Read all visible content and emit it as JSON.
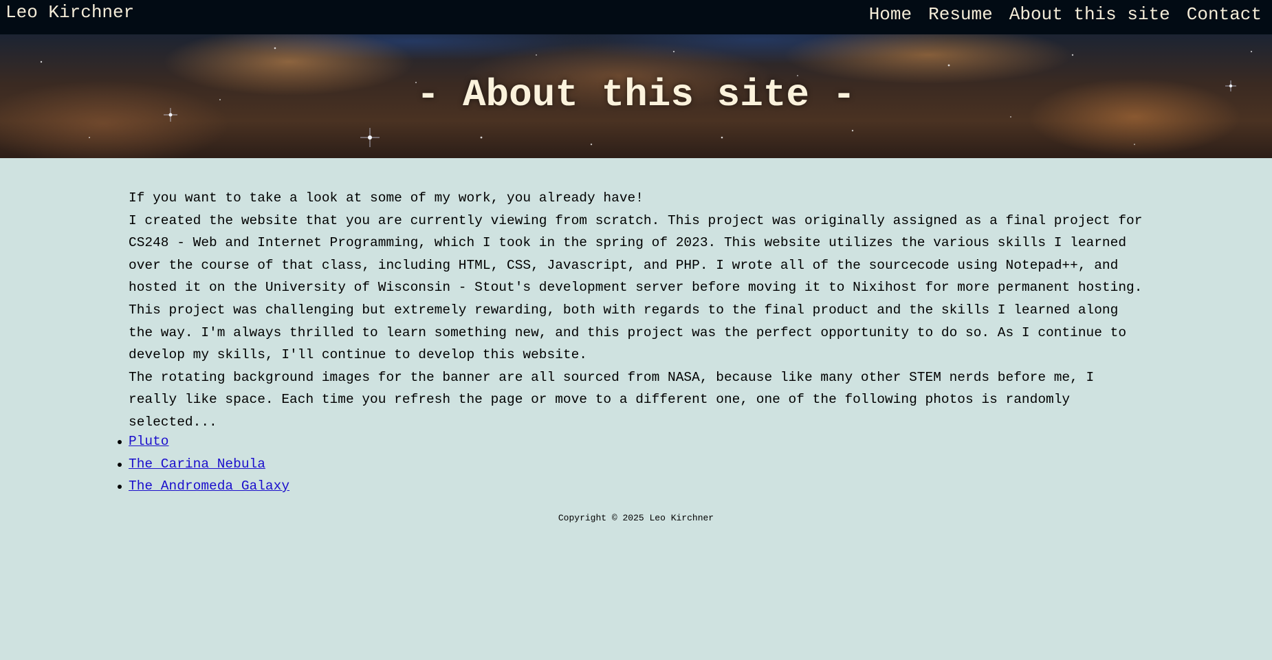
{
  "header": {
    "site_name": "Leo Kirchner",
    "nav": [
      {
        "label": "Home"
      },
      {
        "label": "Resume"
      },
      {
        "label": "About this site"
      },
      {
        "label": "Contact"
      }
    ]
  },
  "banner": {
    "title": "- About this site -"
  },
  "main": {
    "paragraphs": [
      "If you want to take a look at some of my work, you already have!",
      "I created the website that you are currently viewing from scratch. This project was originally assigned as a final project for CS248 - Web and Internet Programming, which I took in the spring of 2023. This website utilizes the various skills I learned over the course of that class, including HTML, CSS, Javascript, and PHP. I wrote all of the sourcecode using Notepad++, and hosted it on the University of Wisconsin - Stout's development server before moving it to Nixihost for more permanent hosting.",
      "This project was challenging but extremely rewarding, both with regards to the final product and the skills I learned along the way. I'm always thrilled to learn something new, and this project was the perfect opportunity to do so. As I continue to develop my skills, I'll continue to develop this website.",
      "The rotating background images for the banner are all sourced from NASA, because like many other STEM nerds before me, I really like space. Each time you refresh the page or move to a different one, one of the following photos is randomly selected..."
    ],
    "photo_links": [
      {
        "label": "Pluto"
      },
      {
        "label": "The Carina Nebula"
      },
      {
        "label": "The Andromeda Galaxy"
      }
    ]
  },
  "footer": {
    "copyright": "Copyright © 2025 Leo Kirchner"
  },
  "colors": {
    "topbar_bg": "#020b14",
    "page_bg": "#cfe2e0",
    "title_text": "#fbf2dc",
    "link": "#1a0ecc"
  }
}
